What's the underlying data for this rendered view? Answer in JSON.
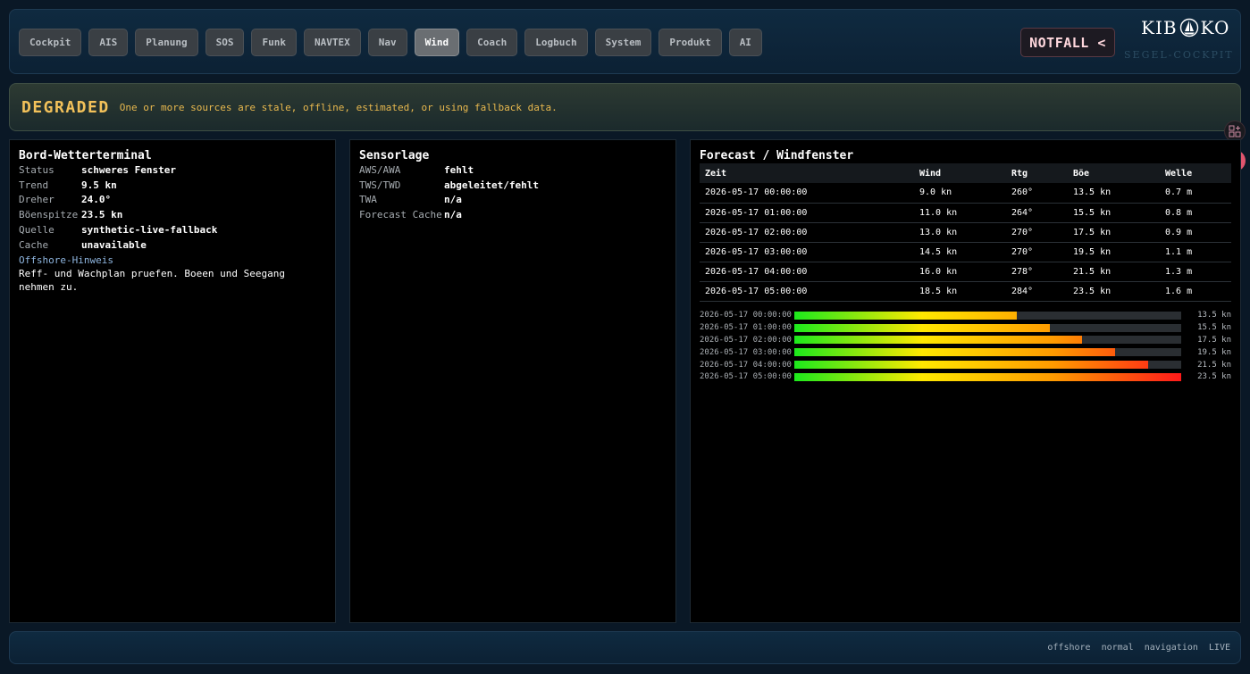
{
  "nav": {
    "tabs": [
      {
        "label": "Cockpit",
        "active": false
      },
      {
        "label": "AIS",
        "active": false
      },
      {
        "label": "Planung",
        "active": false
      },
      {
        "label": "SOS",
        "active": false
      },
      {
        "label": "Funk",
        "active": false
      },
      {
        "label": "NAVTEX",
        "active": false
      },
      {
        "label": "Nav",
        "active": false
      },
      {
        "label": "Wind",
        "active": true
      },
      {
        "label": "Coach",
        "active": false
      },
      {
        "label": "Logbuch",
        "active": false
      },
      {
        "label": "System",
        "active": false
      },
      {
        "label": "Produkt",
        "active": false
      },
      {
        "label": "AI",
        "active": false
      }
    ],
    "emergency_label": "NOTFALL <"
  },
  "logo": {
    "left": "KIB",
    "right": "KO",
    "subtitle": "SEGEL-COCKPIT"
  },
  "banner": {
    "status": "DEGRADED",
    "message": "One or more sources are stale, offline, estimated, or using fallback data."
  },
  "weather_panel": {
    "title": "Bord-Wetterterminal",
    "rows": [
      {
        "key": "Status",
        "value": "schweres Fenster"
      },
      {
        "key": "Trend",
        "value": "9.5 kn"
      },
      {
        "key": "Dreher",
        "value": "24.0°"
      },
      {
        "key": "Böenspitze",
        "value": "23.5 kn"
      },
      {
        "key": "Quelle",
        "value": "synthetic-live-fallback"
      },
      {
        "key": "Cache",
        "value": "unavailable"
      }
    ],
    "hint_title": "Offshore-Hinweis",
    "hint_text": "Reff- und Wachplan pruefen. Boeen und Seegang nehmen zu."
  },
  "sensor_panel": {
    "title": "Sensorlage",
    "rows": [
      {
        "key": "AWS/AWA",
        "value": "fehlt"
      },
      {
        "key": "TWS/TWD",
        "value": "abgeleitet/fehlt"
      },
      {
        "key": "TWA",
        "value": "n/a"
      },
      {
        "key": "Forecast Cache",
        "value": "n/a"
      }
    ]
  },
  "forecast_panel": {
    "title": "Forecast / Windfenster",
    "columns": [
      "Zeit",
      "Wind",
      "Rtg",
      "Böe",
      "Welle"
    ],
    "rows": [
      [
        "2026-05-17 00:00:00",
        "9.0 kn",
        "260°",
        "13.5 kn",
        "0.7 m"
      ],
      [
        "2026-05-17 01:00:00",
        "11.0 kn",
        "264°",
        "15.5 kn",
        "0.8 m"
      ],
      [
        "2026-05-17 02:00:00",
        "13.0 kn",
        "270°",
        "17.5 kn",
        "0.9 m"
      ],
      [
        "2026-05-17 03:00:00",
        "14.5 kn",
        "270°",
        "19.5 kn",
        "1.1 m"
      ],
      [
        "2026-05-17 04:00:00",
        "16.0 kn",
        "278°",
        "21.5 kn",
        "1.3 m"
      ],
      [
        "2026-05-17 05:00:00",
        "18.5 kn",
        "284°",
        "23.5 kn",
        "1.6 m"
      ]
    ]
  },
  "chart_data": {
    "type": "bar",
    "categories": [
      "2026-05-17 00:00:00",
      "2026-05-17 01:00:00",
      "2026-05-17 02:00:00",
      "2026-05-17 03:00:00",
      "2026-05-17 04:00:00",
      "2026-05-17 05:00:00"
    ],
    "values": [
      13.5,
      15.5,
      17.5,
      19.5,
      21.5,
      23.5
    ],
    "value_labels": [
      "13.5 kn",
      "15.5 kn",
      "17.5 kn",
      "19.5 kn",
      "21.5 kn",
      "23.5 kn"
    ],
    "xlim": [
      0,
      23.5
    ],
    "orientation": "horizontal",
    "colors": [
      "#1ce91c",
      "#ffe800",
      "#ff9a00",
      "#ff1a1a"
    ]
  },
  "footer": {
    "items": [
      "offshore",
      "normal",
      "navigation",
      "LIVE"
    ]
  }
}
